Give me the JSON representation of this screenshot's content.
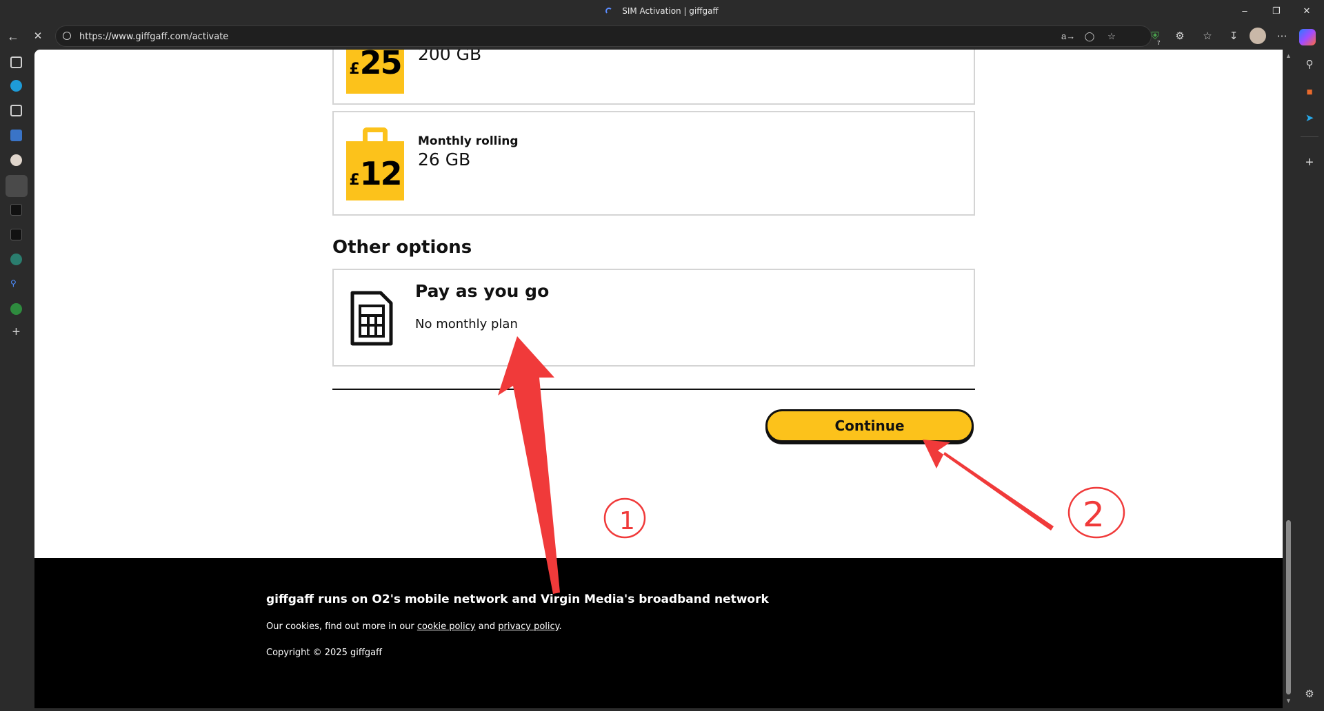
{
  "browser": {
    "tab_title": "SIM Activation | giffgaff",
    "url": "https://www.giffgaff.com/activate",
    "extensions_badge": "7"
  },
  "plans": [
    {
      "price_symbol": "£",
      "price_amount": "25",
      "name": "",
      "data": "200 GB"
    },
    {
      "price_symbol": "£",
      "price_amount": "12",
      "name": "Monthly rolling",
      "data": "26 GB"
    }
  ],
  "other_options": {
    "heading": "Other options",
    "payg": {
      "title": "Pay as you go",
      "subtitle": "No monthly plan"
    }
  },
  "actions": {
    "continue_label": "Continue"
  },
  "footer": {
    "headline": "giffgaff runs on O2's mobile network and Virgin Media's broadband network",
    "cookie_prefix": "Our cookies, find out more in our",
    "cookie_link": "cookie policy",
    "cookie_and": "and",
    "privacy_link": "privacy policy",
    "cookie_suffix": ".",
    "copyright": "Copyright © 2025 giffgaff"
  },
  "annotations": {
    "marker_1": "1",
    "marker_2": "2",
    "color": "#f03a3a"
  },
  "colors": {
    "brand_yellow": "#fcc21b",
    "footer_bg": "#000000"
  }
}
